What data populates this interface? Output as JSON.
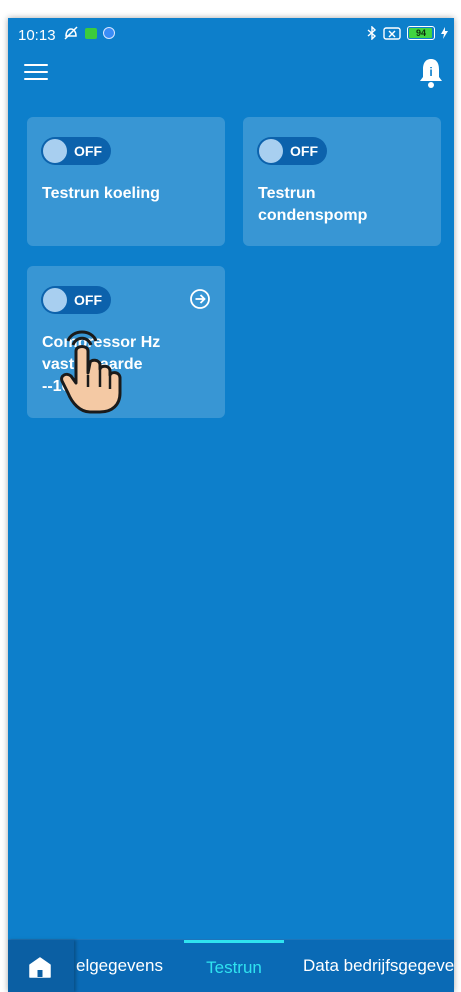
{
  "status_bar": {
    "time": "10:13",
    "battery": "94"
  },
  "cards": [
    {
      "toggle_state": "OFF",
      "title": "Testrun koeling"
    },
    {
      "toggle_state": "OFF",
      "title": "Testrun condenspomp"
    },
    {
      "toggle_state": "OFF",
      "title_line1": "Compressor Hz",
      "title_line2": "vaste waarde",
      "title_line3": "--10 Hz--"
    }
  ],
  "tabs": [
    {
      "label": "elgegevens",
      "active": false
    },
    {
      "label": "Testrun",
      "active": true
    },
    {
      "label": "Data bedrijfsgegevens",
      "active": false
    }
  ],
  "colors": {
    "background": "#0d7fcb",
    "active_tab": "#2fe3f0"
  },
  "icons": {
    "menu": "hamburger-icon",
    "notifications": "bell-icon",
    "card_arrow": "arrow-circle-right-icon",
    "home": "home-icon",
    "pointer": "hand-pointer-icon"
  }
}
